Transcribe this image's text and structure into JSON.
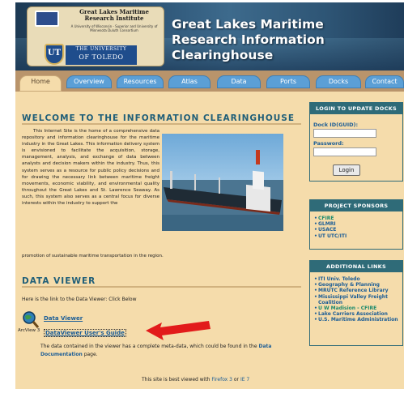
{
  "banner": {
    "glmri_title": "Great Lakes Maritime Research Institute",
    "glmri_subtitle": "A University of Wisconsin - Superior and University of Minnesota Duluth Consortium",
    "ut_mark": "UT",
    "ut_line1": "THE UNIVERSITY",
    "ut_line2": "OF TOLEDO",
    "title_line1": "Great Lakes Maritime",
    "title_line2": "Research Information",
    "title_line3": "Clearinghouse"
  },
  "nav": {
    "tabs": [
      {
        "label": "Home",
        "active": true
      },
      {
        "label": "Overview"
      },
      {
        "label": "Resources"
      },
      {
        "label": "Atlas"
      },
      {
        "label": "Data"
      },
      {
        "label": "Ports"
      },
      {
        "label": "Docks"
      },
      {
        "label": "Contact"
      }
    ]
  },
  "welcome": {
    "heading": "WELCOME TO THE INFORMATION CLEARINGHOUSE",
    "body": "This Internet Site is the home of a comprehensive data repository and information clearinghouse for the maritime industry in the Great Lakes. This information delivery system is envisioned to facilitate the acquisition, storage, management, analysis, and exchange of data between analysts and decision makers within the industry. Thus, this system serves as a resource for public policy decisions and for drawing the necessary link between maritime freight movements, economic viability, and environmental quality throughout the Great Lakes and St. Lawrence Seaway. As such, this system also serves as a central focus for diverse interests within the industry to support the",
    "body_end": "promotion of sustainable maritime transportation in the region."
  },
  "data_viewer": {
    "heading": "DATA VIEWER",
    "intro": "Here is the link to the Data Viewer: Click Below",
    "icon_label": "ArcView 3",
    "viewer_link": "Data Viewer",
    "guide_link": "DataViewer User's Guide",
    "meta_text_before": "The data contained in the viewer has a complete meta-data, which could be found in the",
    "meta_link": "Data Documentation",
    "meta_text_after": "page."
  },
  "footer": {
    "before": "This site is best viewed with",
    "firefox": "Firefox 3",
    "or": "or",
    "ie": "IE 7"
  },
  "login": {
    "title": "LOGIN TO UPDATE DOCKS",
    "dock_label": "Dock ID(GUID):",
    "dock_value": "",
    "password_label": "Password:",
    "password_value": "",
    "button": "Login"
  },
  "sponsors": {
    "title": "PROJECT SPONSORS",
    "items": [
      {
        "label": "CFIRE",
        "color": "green"
      },
      {
        "label": "GLMRI"
      },
      {
        "label": "USACE"
      },
      {
        "label": "UT UTC/ITI"
      }
    ]
  },
  "links": {
    "title": "ADDITIONAL LINKS",
    "items": [
      {
        "label": "ITI Univ. Toledo"
      },
      {
        "label": "Geography & Planning"
      },
      {
        "label": "MRUTC Reference Library"
      },
      {
        "label": "Mississippi Valley Freight Coalition"
      },
      {
        "label": "U W Madision - CFIRE",
        "color": "green"
      },
      {
        "label": "Lake Carriers Association"
      },
      {
        "label": "U.S. Maritime Administration"
      }
    ]
  },
  "colors": {
    "background": "#f5dcab",
    "nav_bar": "#b9946b",
    "tab": "#5b9fd6",
    "heading": "#1f5e78",
    "link": "#1a5c96",
    "sidebar_title": "#2f6b78",
    "arrow": "#e21b1b"
  },
  "icons": {
    "arcview": "arcview-globe-magnifier-icon",
    "arrow": "red-arrow-icon"
  }
}
